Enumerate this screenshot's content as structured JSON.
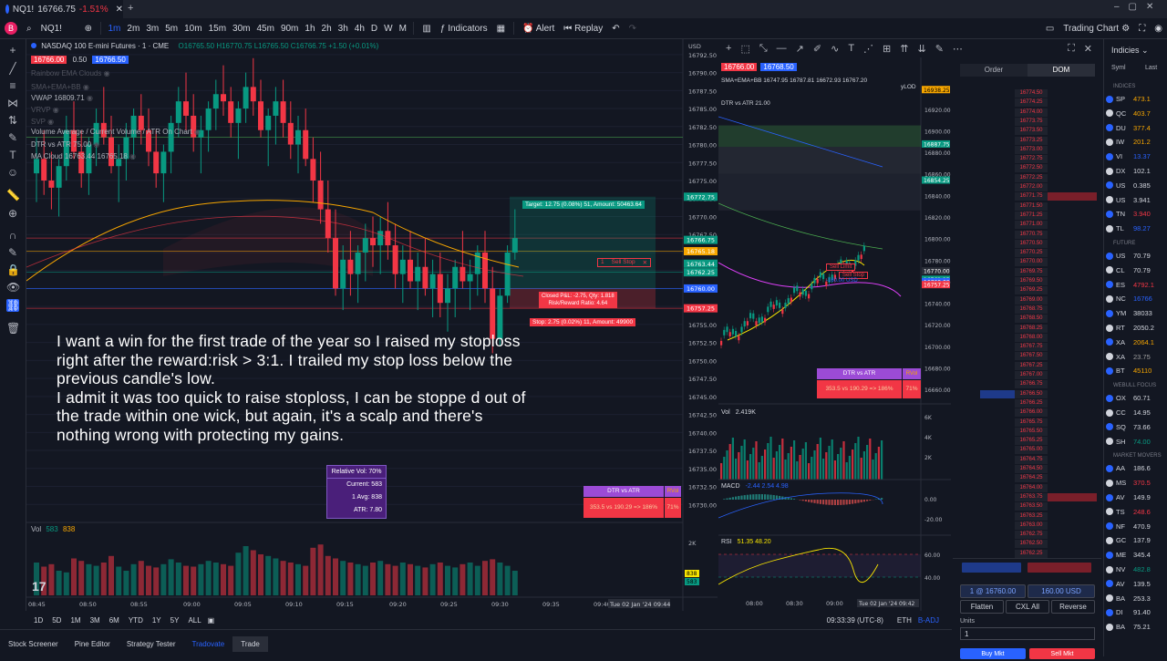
{
  "browser": {
    "tab_symbol": "NQ1!",
    "tab_price": "16766.75",
    "tab_change": "-1.51%"
  },
  "toolbar": {
    "avatar_letter": "B",
    "symbol": "NQ1!",
    "timeframes": [
      "1m",
      "2m",
      "3m",
      "5m",
      "10m",
      "15m",
      "30m",
      "45m",
      "90m",
      "1h",
      "2h",
      "3h",
      "4h",
      "D",
      "W",
      "M"
    ],
    "active_timeframe": "1m",
    "indicators_label": "Indicators",
    "alert_label": "Alert",
    "replay_label": "Replay",
    "layout_label": "Trading Chart"
  },
  "legend": {
    "title": "NASDAQ 100 E-mini Futures · 1 · CME",
    "ohlc": "O16765.50 H16770.75 L16765.50 C16766.75 +1.50 (+0.01%)",
    "bid": "16766.00",
    "spread": "0.50",
    "ask": "16766.50",
    "indicators": [
      "Rainbow EMA Clouds",
      "SMA+EMA+BB",
      "VWAP  16809.71",
      "VRVP",
      "SVP",
      "Volume Average / Current Volume / ATR On Chart",
      "DTR vs ATR  75.00",
      "MA Cloud  16763.44  16765.18"
    ],
    "vol_label": "Vol",
    "vol_value_1": "583",
    "vol_value_2": "838"
  },
  "price_axis": {
    "unit": "USD",
    "ticks": [
      "16792.50",
      "16790.00",
      "16787.50",
      "16785.00",
      "16782.50",
      "16780.00",
      "16777.50",
      "16775.00",
      "16772.50",
      "16770.00",
      "16767.50",
      "16765.00",
      "16762.50",
      "16760.00",
      "16757.50",
      "16755.00",
      "16752.50",
      "16750.00",
      "16747.50",
      "16745.00",
      "16742.50",
      "16740.00",
      "16737.50",
      "16735.00",
      "16732.50",
      "16730.00"
    ],
    "labels": [
      {
        "text": "16772.75",
        "color": "#089981"
      },
      {
        "text": "16766.75",
        "color": "#089981"
      },
      {
        "text": "16765.18",
        "color": "#f7a600"
      },
      {
        "text": "16763.44",
        "color": "#089981"
      },
      {
        "text": "16762.25",
        "color": "#089981"
      },
      {
        "text": "16760.00",
        "color": "#2962ff"
      },
      {
        "text": "16757.25",
        "color": "#f23645"
      }
    ],
    "vol_ticks": [
      "2K"
    ],
    "vol_labels": [
      "838",
      "583"
    ]
  },
  "time_axis": {
    "ticks": [
      "08:45",
      "08:50",
      "08:55",
      "09:00",
      "09:05",
      "09:10",
      "09:15",
      "09:20",
      "09:25",
      "09:30",
      "09:35",
      "09:40"
    ],
    "current": "Tue 02 Jan '24",
    "current_time": "09:44"
  },
  "trade_box": {
    "target": "Target: 12.75 (0.08%) 51, Amount: 50463.64",
    "stop": "Stop: 2.75 (0.02%) 11, Amount: 49900",
    "closed": "Closed P&L: -2.75, Qty: 1.818",
    "ratio": "Risk/Reward Ratio: 4.64",
    "sell_stop_label": "Sell Stop",
    "sell_stop_qty": "1"
  },
  "caption": "I want a win for the first trade of the year so I raised my stoploss right after the reward:risk > 3:1. I trailed my stop loss below the previous candle's low.\nI admit it was too quick to raise stoploss, I can be stoppe d out of the trade within one wick, but again, it's a scalp and there's nothing wrong with protecting my gains.",
  "volume_stats": {
    "rel_vol": "Relative Vol: 70%",
    "current": "Current: 583",
    "avg": "1 Avg: 838",
    "atr": "ATR: 7.80"
  },
  "dtr_table": {
    "header": "DTR vs ATR",
    "header_right": "RVol",
    "value": "353.5 vs 190.29 => 186%",
    "pct": "71%"
  },
  "bottom_range": {
    "ranges": [
      "1D",
      "5D",
      "1M",
      "3M",
      "6M",
      "YTD",
      "1Y",
      "5Y",
      "ALL"
    ],
    "clock": "09:33:39 (UTC-8)",
    "session": "ETH",
    "adj": "B-ADJ"
  },
  "bottom_tabs": [
    "Stock Screener",
    "Pine Editor",
    "Strategy Tester",
    "Tradovate",
    "Trade"
  ],
  "right_chart": {
    "bid": "16766.00",
    "ask": "16768.50",
    "indicator_line": "SMA+EMA+BB  16747.95  16787.81  16672.93  16767.20",
    "dtr_label": "DTR vs ATR  21.00",
    "ticks": [
      "16920.00",
      "16900.00",
      "16880.00",
      "16860.00",
      "16840.00",
      "16820.00",
      "16800.00",
      "16780.00",
      "16760.00",
      "16740.00",
      "16720.00",
      "16700.00",
      "16680.00",
      "16660.00"
    ],
    "labels": [
      {
        "text": "16938.25",
        "color": "#f7a600"
      },
      {
        "text": "16887.75",
        "color": "#089981"
      },
      {
        "text": "16854.25",
        "color": "#089981"
      },
      {
        "text": "16770.00",
        "color": "#2a2e39"
      },
      {
        "text": "16762.25",
        "color": "#089981"
      },
      {
        "text": "16760.00",
        "color": "#2962ff"
      },
      {
        "text": "16757.25",
        "color": "#f23645"
      }
    ],
    "ylod": "yLOD",
    "sell_limit": "Sell Limit",
    "sell_stop": "Sell Stop",
    "usd_tag": "-160.00 USD",
    "vol_label": "Vol",
    "vol_value": "2.419K",
    "vol_ticks": [
      "6K",
      "4K",
      "2K"
    ],
    "macd_label": "MACD",
    "macd_vals": "-2.44  2.54  4.98",
    "macd_ticks": [
      "0.00",
      "-20.00"
    ],
    "rsi_label": "RSI",
    "rsi_vals": "51.35  48.20",
    "rsi_ticks": [
      "60.00",
      "40.00"
    ],
    "time_ticks": [
      "08:00",
      "08:30",
      "09:00"
    ],
    "time_current": "Tue 02 Jan '24",
    "time_clock": "09:42"
  },
  "dom": {
    "tab_order": "Order",
    "tab_dom": "DOM",
    "prices": [
      "16774.50",
      "16774.25",
      "16774.00",
      "16773.75",
      "16773.50",
      "16773.25",
      "16773.00",
      "16772.75",
      "16772.50",
      "16772.25",
      "16772.00",
      "16771.75",
      "16771.50",
      "16771.25",
      "16771.00",
      "16770.75",
      "16770.50",
      "16770.25",
      "16770.00",
      "16769.75",
      "16769.50",
      "16769.25",
      "16769.00",
      "16768.75",
      "16768.50",
      "16768.25",
      "16768.00",
      "16767.75",
      "16767.50",
      "16767.25",
      "16767.00",
      "16766.75",
      "16766.50",
      "16766.25",
      "16766.00",
      "16765.75",
      "16765.50",
      "16765.25",
      "16765.00",
      "16764.75",
      "16764.50",
      "16764.25",
      "16764.00",
      "16763.75",
      "16763.50",
      "16763.25",
      "16763.00",
      "16762.75",
      "16762.50",
      "16762.25"
    ],
    "flatten": "Flatten",
    "cxl_all": "CXL All",
    "reverse": "Reverse",
    "position_price": "1 @ 16760.00",
    "position_pnl": "160.00 USD",
    "units_label": "Units",
    "units_value": "1",
    "buy": "Buy Mkt",
    "sell": "Sell Mkt"
  },
  "watchlist": {
    "header": "Indicies",
    "col_sym": "Syml",
    "col_last": "Last",
    "sections": [
      "INDICES",
      "FUTURE",
      "WEBULL FOCUS",
      "MARKET MOVERS"
    ],
    "indices": [
      {
        "sym": "SP",
        "last": "473.1",
        "color": "#f7a600"
      },
      {
        "sym": "QC",
        "last": "403.7",
        "color": "#f7a600"
      },
      {
        "sym": "DU",
        "last": "377.4",
        "color": "#f7a600"
      },
      {
        "sym": "IW",
        "last": "201.2",
        "color": "#f7a600"
      },
      {
        "sym": "VI",
        "last": "13.37",
        "color": "#2962ff"
      },
      {
        "sym": "DX",
        "last": "102.1",
        "color": "#d1d4dc"
      },
      {
        "sym": "US",
        "last": "0.385",
        "color": "#d1d4dc"
      },
      {
        "sym": "US",
        "last": "3.941",
        "color": "#d1d4dc"
      },
      {
        "sym": "TN",
        "last": "3.940",
        "color": "#f23645"
      },
      {
        "sym": "TL",
        "last": "98.27",
        "color": "#2962ff"
      }
    ],
    "futures": [
      {
        "sym": "US",
        "last": "70.79",
        "color": "#d1d4dc"
      },
      {
        "sym": "CL",
        "last": "70.79",
        "color": "#d1d4dc"
      },
      {
        "sym": "ES",
        "last": "4792.1",
        "color": "#f23645"
      },
      {
        "sym": "NC",
        "last": "16766",
        "color": "#2962ff"
      },
      {
        "sym": "YM",
        "last": "38033",
        "color": "#d1d4dc"
      },
      {
        "sym": "RT",
        "last": "2050.2",
        "color": "#d1d4dc"
      },
      {
        "sym": "XA",
        "last": "2064.1",
        "color": "#f7a600"
      },
      {
        "sym": "XA",
        "last": "23.75",
        "color": "#9e9e9e"
      },
      {
        "sym": "BT",
        "last": "45110",
        "color": "#f7a600"
      }
    ],
    "focus": [
      {
        "sym": "OX",
        "last": "60.71",
        "color": "#d1d4dc"
      },
      {
        "sym": "CC",
        "last": "14.95",
        "color": "#d1d4dc"
      },
      {
        "sym": "SQ",
        "last": "73.66",
        "color": "#d1d4dc"
      },
      {
        "sym": "SH",
        "last": "74.00",
        "color": "#089981"
      }
    ],
    "movers": [
      {
        "sym": "AA",
        "last": "186.6",
        "color": "#d1d4dc"
      },
      {
        "sym": "MS",
        "last": "370.5",
        "color": "#f23645"
      },
      {
        "sym": "AV",
        "last": "149.9",
        "color": "#d1d4dc"
      },
      {
        "sym": "TS",
        "last": "248.6",
        "color": "#f23645"
      },
      {
        "sym": "NF",
        "last": "470.9",
        "color": "#d1d4dc"
      },
      {
        "sym": "GC",
        "last": "137.9",
        "color": "#d1d4dc"
      },
      {
        "sym": "ME",
        "last": "345.4",
        "color": "#d1d4dc"
      },
      {
        "sym": "NV",
        "last": "482.8",
        "color": "#089981"
      },
      {
        "sym": "AV",
        "last": "139.5",
        "color": "#d1d4dc"
      },
      {
        "sym": "BA",
        "last": "253.3",
        "color": "#d1d4dc"
      },
      {
        "sym": "DI",
        "last": "91.40",
        "color": "#d1d4dc"
      },
      {
        "sym": "BA",
        "last": "75.21",
        "color": "#d1d4dc"
      }
    ]
  },
  "colors": {
    "up": "#089981",
    "down": "#f23645",
    "accent": "#2962ff",
    "background": "#131722"
  }
}
